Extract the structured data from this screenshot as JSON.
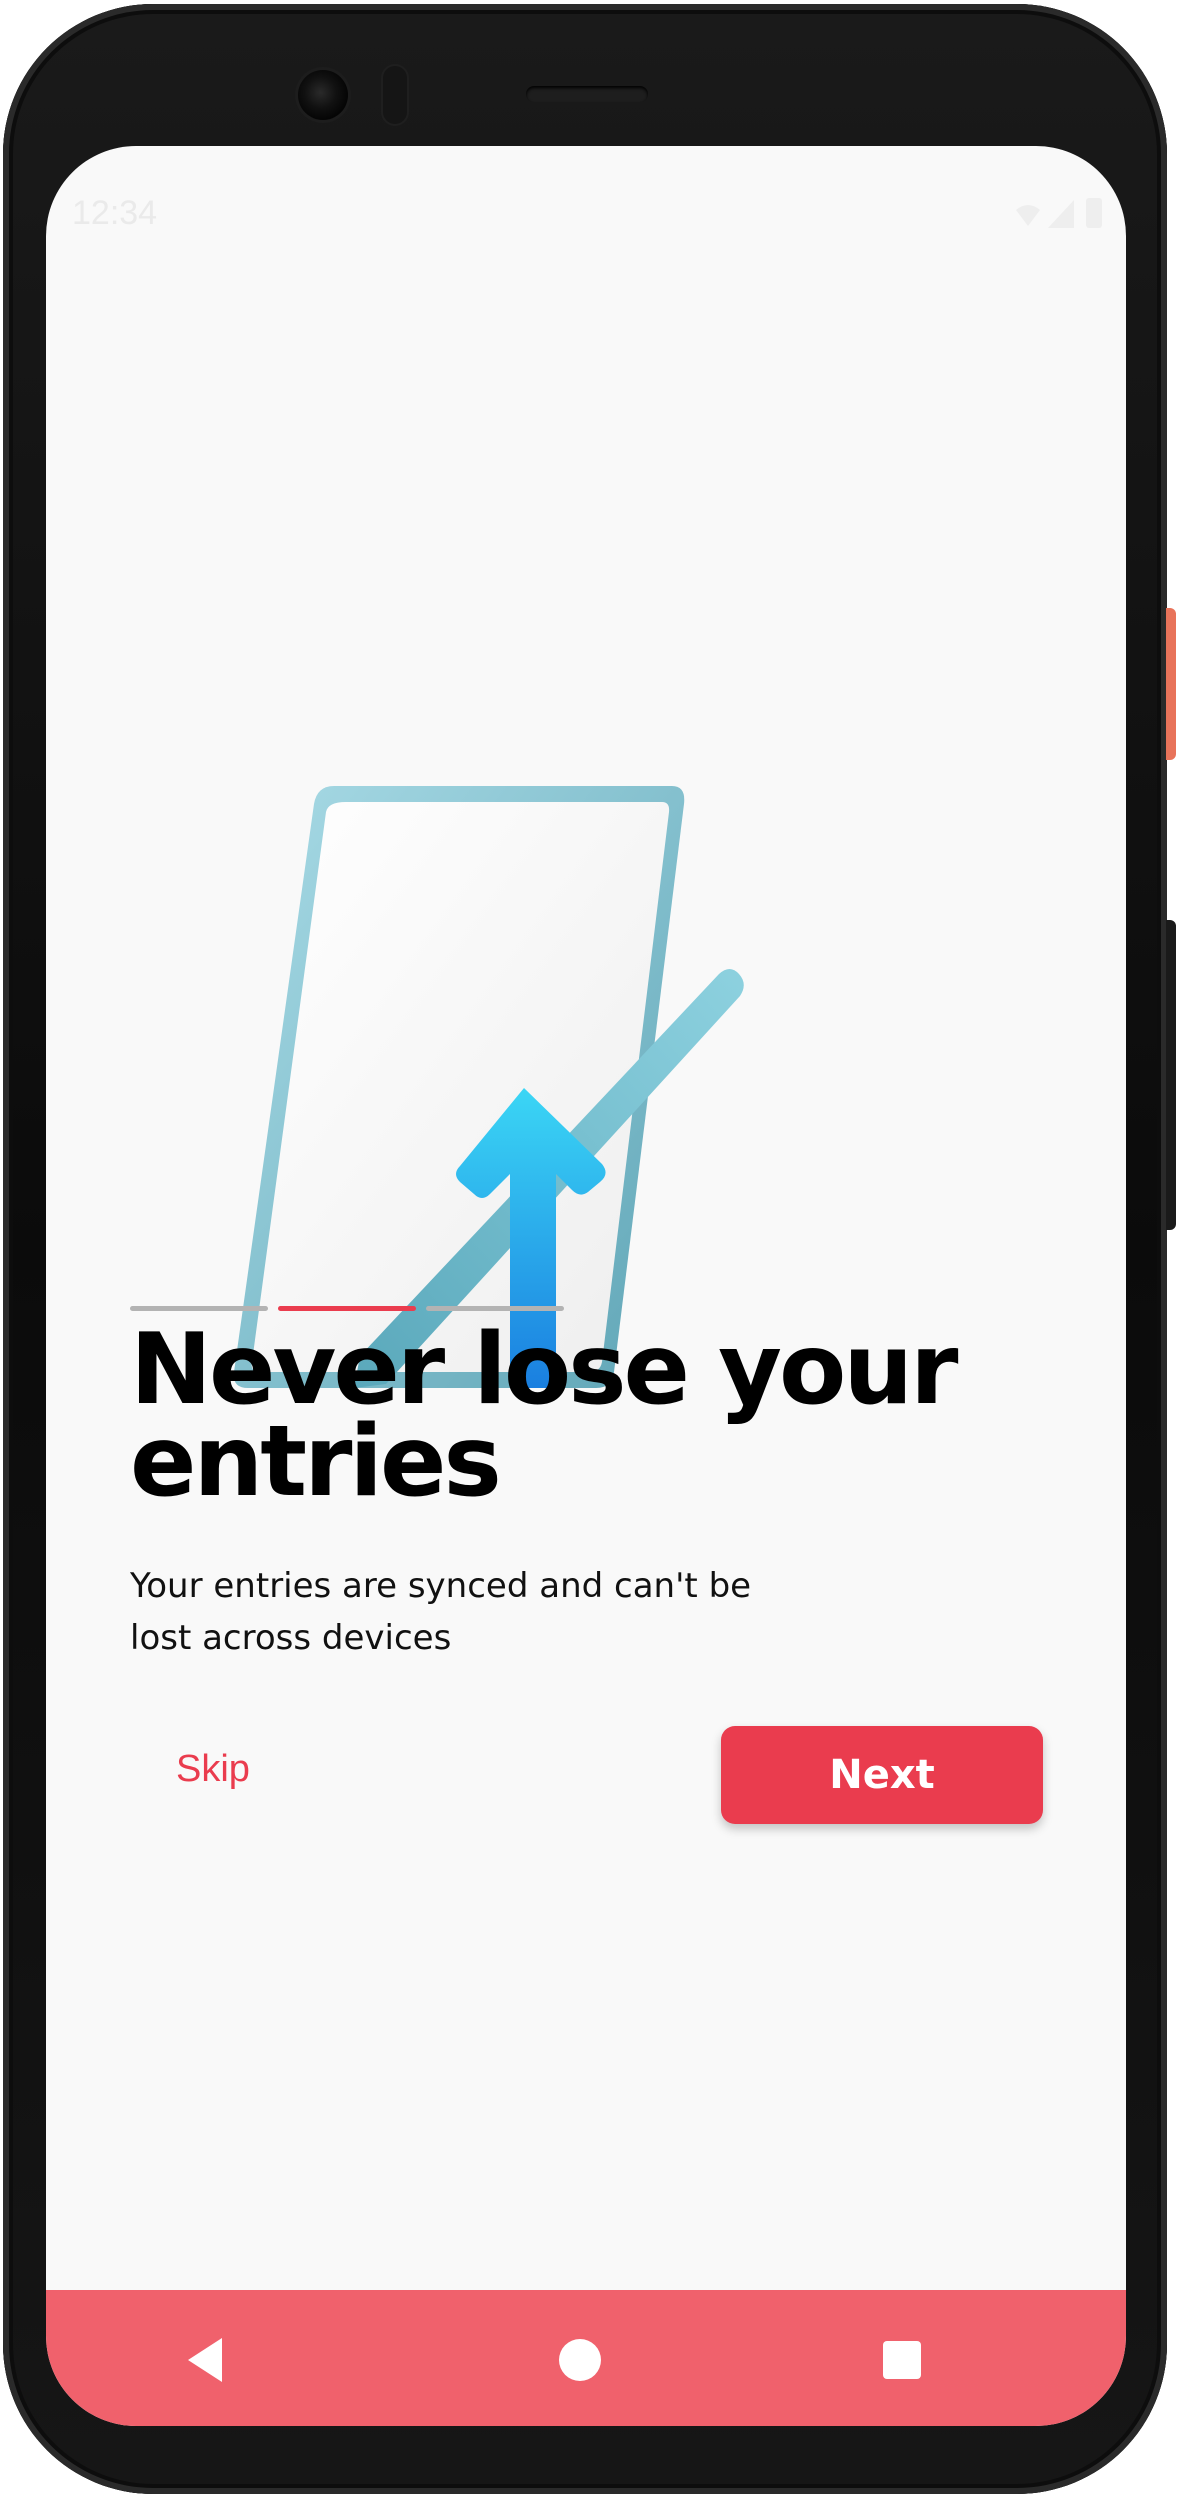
{
  "status_bar": {
    "time": "12:34",
    "icons": [
      "wifi-icon",
      "signal-icon",
      "battery-icon"
    ]
  },
  "onboarding": {
    "illustration": "tablet-with-pen-and-upload-arrow",
    "pages_total": 3,
    "current_page": 2,
    "title": "Never lose your entries",
    "subtitle": "Your entries are synced and can't be lost across devices",
    "skip_label": "Skip",
    "next_label": "Next"
  },
  "nav_bar": {
    "buttons": [
      "back-icon",
      "home-icon",
      "recents-icon"
    ]
  },
  "colors": {
    "accent": "#ea3c4e",
    "nav_bar": "#f0616c",
    "indicator_inactive": "#b3b3b3",
    "background": "#f9f9f9"
  }
}
